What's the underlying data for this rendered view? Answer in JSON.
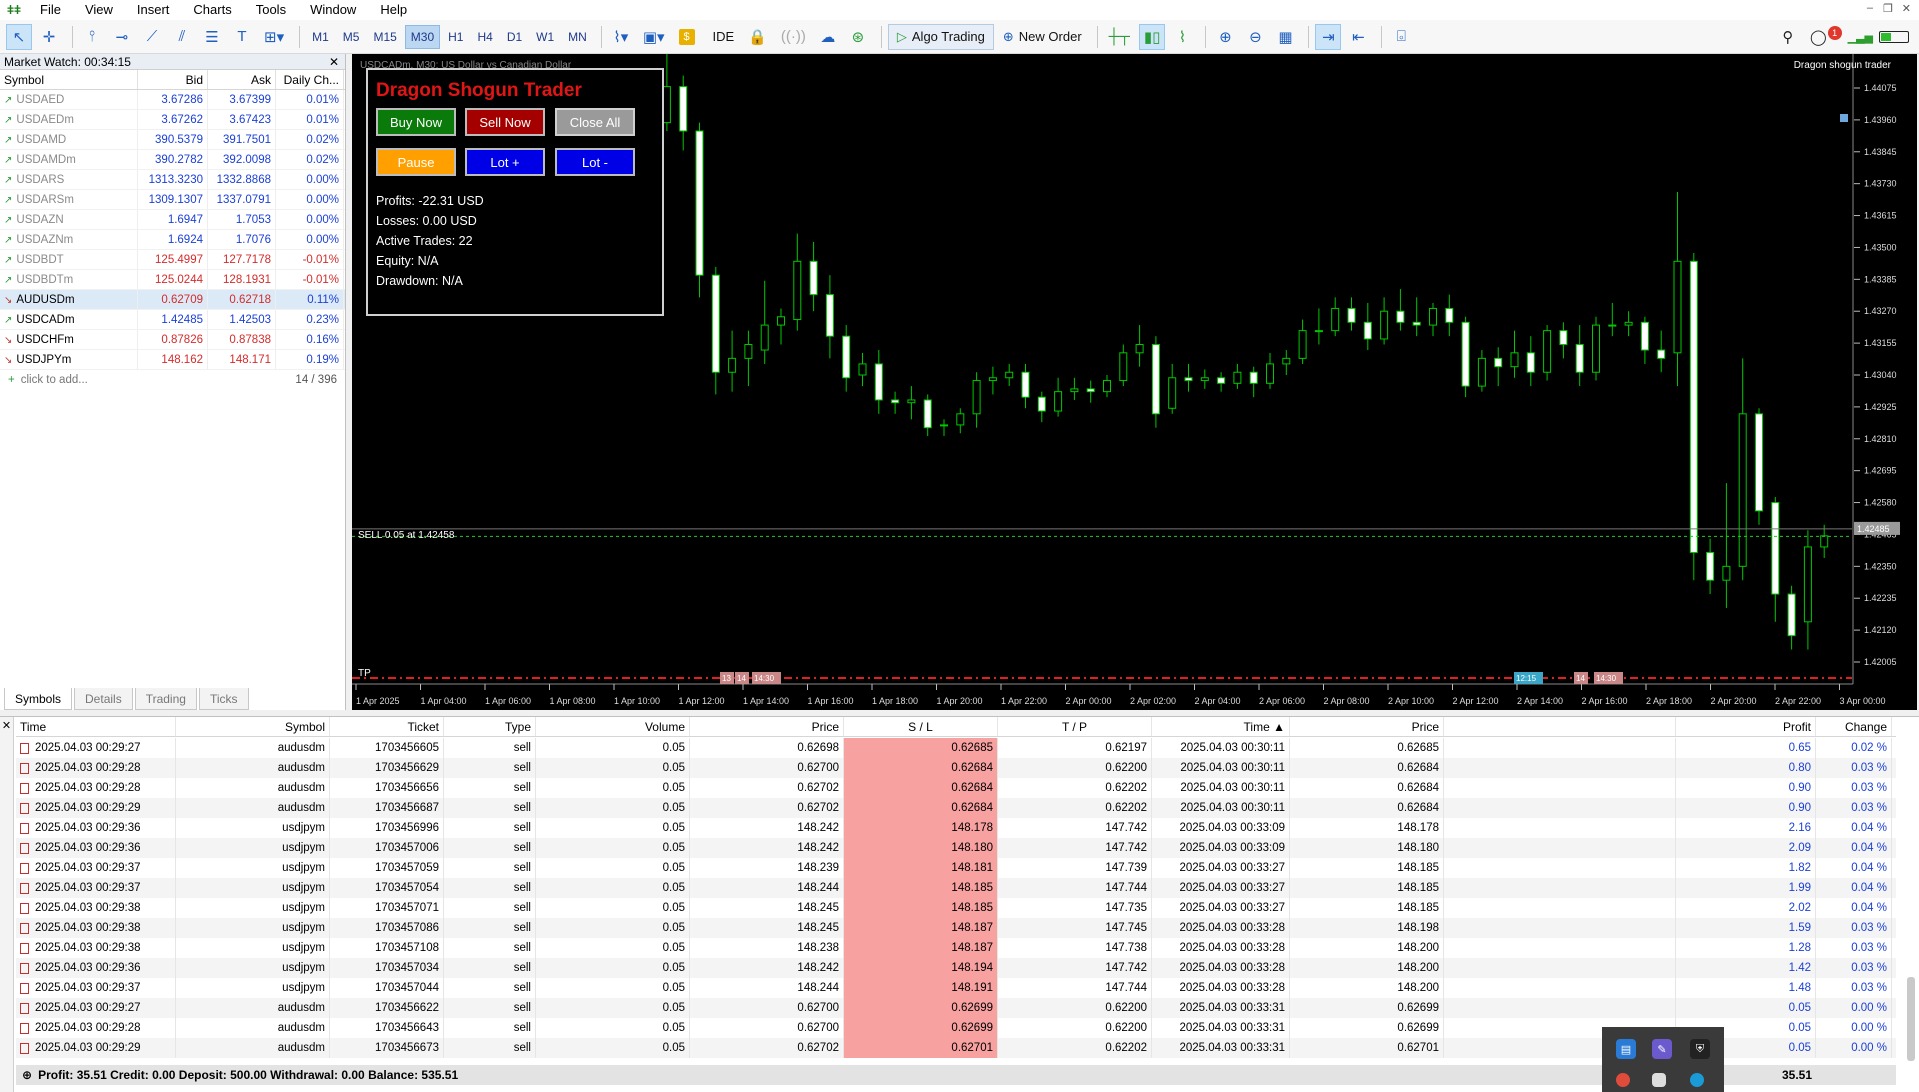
{
  "menu": [
    "File",
    "View",
    "Insert",
    "Charts",
    "Tools",
    "Window",
    "Help"
  ],
  "toolbar": {
    "timeframes": [
      "M1",
      "M5",
      "M15",
      "M30",
      "H1",
      "H4",
      "D1",
      "W1",
      "MN"
    ],
    "active_timeframe": "M30",
    "ide_label": "IDE",
    "algo_label": "Algo Trading",
    "new_order_label": "New Order",
    "notify_count": "1"
  },
  "market_watch": {
    "title": "Market Watch: 00:34:15",
    "columns": [
      "Symbol",
      "Bid",
      "Ask",
      "Daily Ch..."
    ],
    "rows": [
      {
        "symbol": "USDAED",
        "bid": "3.67286",
        "ask": "3.67399",
        "change": "0.01%",
        "dir": "up",
        "active": false
      },
      {
        "symbol": "USDAEDm",
        "bid": "3.67262",
        "ask": "3.67423",
        "change": "0.01%",
        "dir": "up",
        "active": false
      },
      {
        "symbol": "USDAMD",
        "bid": "390.5379",
        "ask": "391.7501",
        "change": "0.02%",
        "dir": "up",
        "active": false
      },
      {
        "symbol": "USDAMDm",
        "bid": "390.2782",
        "ask": "392.0098",
        "change": "0.02%",
        "dir": "up",
        "active": false
      },
      {
        "symbol": "USDARS",
        "bid": "1313.3230",
        "ask": "1332.8868",
        "change": "0.00%",
        "dir": "up",
        "active": false
      },
      {
        "symbol": "USDARSm",
        "bid": "1309.1307",
        "ask": "1337.0791",
        "change": "0.00%",
        "dir": "up",
        "active": false
      },
      {
        "symbol": "USDAZN",
        "bid": "1.6947",
        "ask": "1.7053",
        "change": "0.00%",
        "dir": "up",
        "active": false
      },
      {
        "symbol": "USDAZNm",
        "bid": "1.6924",
        "ask": "1.7076",
        "change": "0.00%",
        "dir": "up",
        "active": false
      },
      {
        "symbol": "USDBDT",
        "bid": "125.4997",
        "ask": "127.7178",
        "change": "-0.01%",
        "dir": "up",
        "active": false
      },
      {
        "symbol": "USDBDTm",
        "bid": "125.0244",
        "ask": "128.1931",
        "change": "-0.01%",
        "dir": "up",
        "active": false
      },
      {
        "symbol": "AUDUSDm",
        "bid": "0.62709",
        "ask": "0.62718",
        "change": "0.11%",
        "dir": "down",
        "active": true
      },
      {
        "symbol": "USDCADm",
        "bid": "1.42485",
        "ask": "1.42503",
        "change": "0.23%",
        "dir": "up",
        "active": true
      },
      {
        "symbol": "USDCHFm",
        "bid": "0.87826",
        "ask": "0.87838",
        "change": "0.16%",
        "dir": "down",
        "active": true
      },
      {
        "symbol": "USDJPYm",
        "bid": "148.162",
        "ask": "148.171",
        "change": "0.19%",
        "dir": "down",
        "active": true
      }
    ],
    "add_label": "click to add...",
    "count": "14 / 396",
    "tabs": [
      "Symbols",
      "Details",
      "Trading",
      "Ticks"
    ]
  },
  "chart": {
    "title_left": "USDCADm, M30: US Dollar vs Canadian Dollar",
    "title_right": "Dragon shogun trader",
    "sell_label": "SELL 0.05 at 1.42458",
    "tp_label": "TP",
    "current_price": "1.42485",
    "price_ticks": [
      "1.44075",
      "1.43960",
      "1.43845",
      "1.43730",
      "1.43615",
      "1.43500",
      "1.43385",
      "1.43270",
      "1.43155",
      "1.43040",
      "1.42925",
      "1.42810",
      "1.42695",
      "1.42580",
      "1.42465",
      "1.42350",
      "1.42235",
      "1.42120",
      "1.42005"
    ],
    "time_ticks": [
      "1 Apr 2025",
      "1 Apr 04:00",
      "1 Apr 06:00",
      "1 Apr 08:00",
      "1 Apr 10:00",
      "1 Apr 12:00",
      "1 Apr 14:00",
      "1 Apr 16:00",
      "1 Apr 18:00",
      "1 Apr 20:00",
      "1 Apr 22:00",
      "2 Apr 00:00",
      "2 Apr 02:00",
      "2 Apr 04:00",
      "2 Apr 06:00",
      "2 Apr 08:00",
      "2 Apr 10:00",
      "2 Apr 12:00",
      "2 Apr 14:00",
      "2 Apr 16:00",
      "2 Apr 18:00",
      "2 Apr 20:00",
      "2 Apr 22:00",
      "3 Apr 00:00"
    ],
    "time_markers": [
      "13",
      "14",
      "14:30",
      "12:15",
      "14",
      "14:30"
    ],
    "colors": {
      "bull": "#000000",
      "bear": "#ffffff",
      "wick": "#00c800",
      "background": "#000000"
    }
  },
  "ea": {
    "title": "Dragon Shogun Trader",
    "buttons": {
      "buy": "Buy Now",
      "sell": "Sell Now",
      "close": "Close All",
      "pause": "Pause",
      "lot_plus": "Lot +",
      "lot_minus": "Lot -"
    },
    "stats": [
      "Profits: -22.31 USD",
      "Losses: 0.00 USD",
      "Active Trades: 22",
      "Equity: N/A",
      "Drawdown: N/A"
    ]
  },
  "terminal": {
    "columns": [
      "Time",
      "Symbol",
      "Ticket",
      "Type",
      "Volume",
      "Price",
      "S / L",
      "T / P",
      "Time",
      "Price",
      "Profit",
      "Change"
    ],
    "rows": [
      {
        "time": "2025.04.03 00:29:27",
        "symbol": "audusdm",
        "ticket": "1703456605",
        "type": "sell",
        "volume": "0.05",
        "price": "0.62698",
        "sl": "0.62685",
        "tp": "0.62197",
        "time2": "2025.04.03 00:30:11",
        "price2": "0.62685",
        "profit": "0.65",
        "change": "0.02 %"
      },
      {
        "time": "2025.04.03 00:29:28",
        "symbol": "audusdm",
        "ticket": "1703456629",
        "type": "sell",
        "volume": "0.05",
        "price": "0.62700",
        "sl": "0.62684",
        "tp": "0.62200",
        "time2": "2025.04.03 00:30:11",
        "price2": "0.62684",
        "profit": "0.80",
        "change": "0.03 %"
      },
      {
        "time": "2025.04.03 00:29:28",
        "symbol": "audusdm",
        "ticket": "1703456656",
        "type": "sell",
        "volume": "0.05",
        "price": "0.62702",
        "sl": "0.62684",
        "tp": "0.62202",
        "time2": "2025.04.03 00:30:11",
        "price2": "0.62684",
        "profit": "0.90",
        "change": "0.03 %"
      },
      {
        "time": "2025.04.03 00:29:29",
        "symbol": "audusdm",
        "ticket": "1703456687",
        "type": "sell",
        "volume": "0.05",
        "price": "0.62702",
        "sl": "0.62684",
        "tp": "0.62202",
        "time2": "2025.04.03 00:30:11",
        "price2": "0.62684",
        "profit": "0.90",
        "change": "0.03 %"
      },
      {
        "time": "2025.04.03 00:29:36",
        "symbol": "usdjpym",
        "ticket": "1703456996",
        "type": "sell",
        "volume": "0.05",
        "price": "148.242",
        "sl": "148.178",
        "tp": "147.742",
        "time2": "2025.04.03 00:33:09",
        "price2": "148.178",
        "profit": "2.16",
        "change": "0.04 %"
      },
      {
        "time": "2025.04.03 00:29:36",
        "symbol": "usdjpym",
        "ticket": "1703457006",
        "type": "sell",
        "volume": "0.05",
        "price": "148.242",
        "sl": "148.180",
        "tp": "147.742",
        "time2": "2025.04.03 00:33:09",
        "price2": "148.180",
        "profit": "2.09",
        "change": "0.04 %"
      },
      {
        "time": "2025.04.03 00:29:37",
        "symbol": "usdjpym",
        "ticket": "1703457059",
        "type": "sell",
        "volume": "0.05",
        "price": "148.239",
        "sl": "148.181",
        "tp": "147.739",
        "time2": "2025.04.03 00:33:27",
        "price2": "148.185",
        "profit": "1.82",
        "change": "0.04 %"
      },
      {
        "time": "2025.04.03 00:29:37",
        "symbol": "usdjpym",
        "ticket": "1703457054",
        "type": "sell",
        "volume": "0.05",
        "price": "148.244",
        "sl": "148.185",
        "tp": "147.744",
        "time2": "2025.04.03 00:33:27",
        "price2": "148.185",
        "profit": "1.99",
        "change": "0.04 %"
      },
      {
        "time": "2025.04.03 00:29:38",
        "symbol": "usdjpym",
        "ticket": "1703457071",
        "type": "sell",
        "volume": "0.05",
        "price": "148.245",
        "sl": "148.185",
        "tp": "147.735",
        "time2": "2025.04.03 00:33:27",
        "price2": "148.185",
        "profit": "2.02",
        "change": "0.04 %"
      },
      {
        "time": "2025.04.03 00:29:38",
        "symbol": "usdjpym",
        "ticket": "1703457086",
        "type": "sell",
        "volume": "0.05",
        "price": "148.245",
        "sl": "148.187",
        "tp": "147.745",
        "time2": "2025.04.03 00:33:28",
        "price2": "148.198",
        "profit": "1.59",
        "change": "0.03 %"
      },
      {
        "time": "2025.04.03 00:29:38",
        "symbol": "usdjpym",
        "ticket": "1703457108",
        "type": "sell",
        "volume": "0.05",
        "price": "148.238",
        "sl": "148.187",
        "tp": "147.738",
        "time2": "2025.04.03 00:33:28",
        "price2": "148.200",
        "profit": "1.28",
        "change": "0.03 %"
      },
      {
        "time": "2025.04.03 00:29:36",
        "symbol": "usdjpym",
        "ticket": "1703457034",
        "type": "sell",
        "volume": "0.05",
        "price": "148.242",
        "sl": "148.194",
        "tp": "147.742",
        "time2": "2025.04.03 00:33:28",
        "price2": "148.200",
        "profit": "1.42",
        "change": "0.03 %"
      },
      {
        "time": "2025.04.03 00:29:37",
        "symbol": "usdjpym",
        "ticket": "1703457044",
        "type": "sell",
        "volume": "0.05",
        "price": "148.244",
        "sl": "148.191",
        "tp": "147.744",
        "time2": "2025.04.03 00:33:28",
        "price2": "148.200",
        "profit": "1.48",
        "change": "0.03 %"
      },
      {
        "time": "2025.04.03 00:29:27",
        "symbol": "audusdm",
        "ticket": "1703456622",
        "type": "sell",
        "volume": "0.05",
        "price": "0.62700",
        "sl": "0.62699",
        "tp": "0.62200",
        "time2": "2025.04.03 00:33:31",
        "price2": "0.62699",
        "profit": "0.05",
        "change": "0.00 %"
      },
      {
        "time": "2025.04.03 00:29:28",
        "symbol": "audusdm",
        "ticket": "1703456643",
        "type": "sell",
        "volume": "0.05",
        "price": "0.62700",
        "sl": "0.62699",
        "tp": "0.62200",
        "time2": "2025.04.03 00:33:31",
        "price2": "0.62699",
        "profit": "0.05",
        "change": "0.00 %"
      },
      {
        "time": "2025.04.03 00:29:29",
        "symbol": "audusdm",
        "ticket": "1703456673",
        "type": "sell",
        "volume": "0.05",
        "price": "0.62702",
        "sl": "0.62701",
        "tp": "0.62202",
        "time2": "2025.04.03 00:33:31",
        "price2": "0.62701",
        "profit": "0.05",
        "change": "0.00 %"
      }
    ],
    "summary": "Profit: 35.51  Credit: 0.00  Deposit: 500.00  Withdrawal: 0.00  Balance: 535.51",
    "total": "35.51"
  }
}
